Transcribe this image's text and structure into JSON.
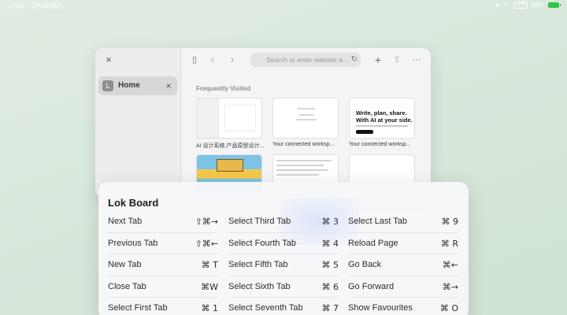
{
  "status_bar": {
    "time": "17:25",
    "date": "2月3日周六",
    "vpn": "VPN",
    "battery": "82%"
  },
  "window": {
    "close_icon": "×",
    "tab": {
      "avatar": "L",
      "label": "Home",
      "close_icon": "×"
    }
  },
  "toolbar": {
    "search_placeholder": "Search or enter website a…",
    "reload_icon": "↻",
    "sidebar_icon": "▯",
    "back_icon": "‹",
    "forward_icon": "›",
    "new_tab_icon": "+",
    "share_icon": "⇪",
    "more_icon": "···"
  },
  "frequently_visited": {
    "title": "Frequently Visited",
    "items": [
      {
        "label": "AI 设计系统,产品原型设计..."
      },
      {
        "label": "Your connected worksp..."
      },
      {
        "label": "Your connected worksp...",
        "hero_line1": "Write, plan, share.",
        "hero_line2": "With AI at your side."
      }
    ]
  },
  "lok_board": {
    "title": "Lok Board",
    "columns": [
      [
        {
          "label": "Next Tab",
          "keys": "⇧⌘→"
        },
        {
          "label": "Previous Tab",
          "keys": "⇧⌘←"
        },
        {
          "label": "New Tab",
          "keys": "⌘ T"
        },
        {
          "label": "Close Tab",
          "keys": "⌘W"
        },
        {
          "label": "Select First Tab",
          "keys": "⌘ 1"
        }
      ],
      [
        {
          "label": "Select Third Tab",
          "keys": "⌘ 3"
        },
        {
          "label": "Select Fourth Tab",
          "keys": "⌘ 4"
        },
        {
          "label": "Select Fifth Tab",
          "keys": "⌘ 5"
        },
        {
          "label": "Select Sixth Tab",
          "keys": "⌘ 6"
        },
        {
          "label": "Select Seventh Tab",
          "keys": "⌘ 7"
        }
      ],
      [
        {
          "label": "Select Last Tab",
          "keys": "⌘ 9"
        },
        {
          "label": "Reload Page",
          "keys": "⌘ R"
        },
        {
          "label": "Go Back",
          "keys": "⌘←"
        },
        {
          "label": "Go Forward",
          "keys": "⌘→"
        },
        {
          "label": "Show Favourites",
          "keys": "⌘ O"
        }
      ]
    ]
  },
  "colors": {
    "background": "#d9e7db",
    "battery": "#30c54a"
  }
}
